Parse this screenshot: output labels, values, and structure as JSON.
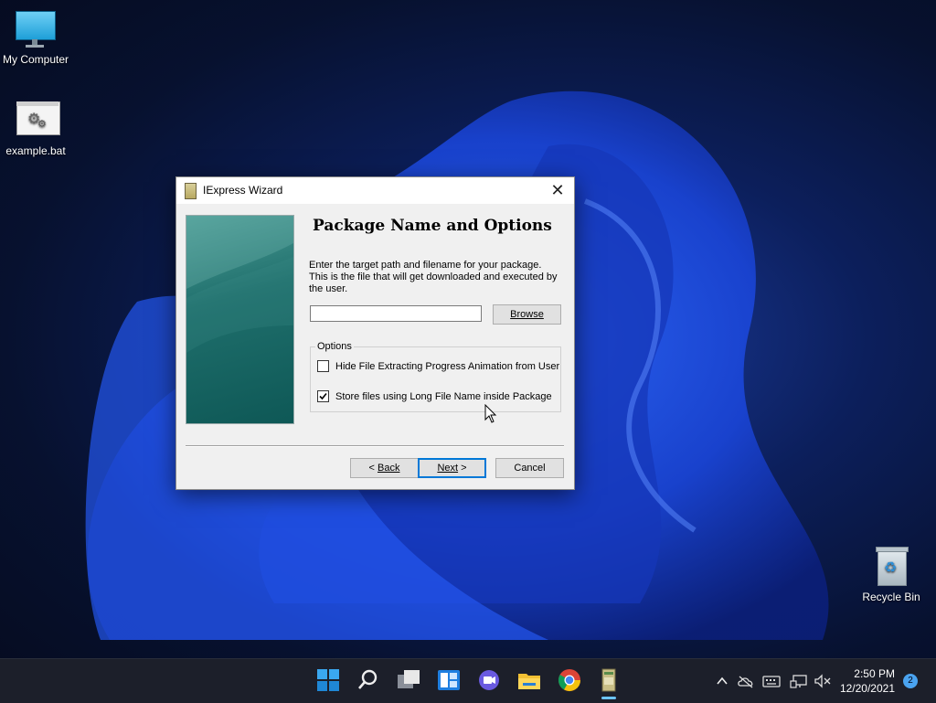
{
  "desktop": {
    "icons": [
      {
        "label": "My Computer"
      },
      {
        "label": "example.bat"
      },
      {
        "label": "Recycle Bin"
      }
    ]
  },
  "dialog": {
    "title": "IExpress Wizard",
    "close_glyph": "✕",
    "heading": "Package Name and Options",
    "description": "Enter the target path and filename for your package. This is the file that will get downloaded and executed by the user.",
    "path_value": "",
    "browse_label": "Browse",
    "options_legend": "Options",
    "options": [
      {
        "label": "Hide File Extracting Progress Animation from User",
        "checked": false
      },
      {
        "label": "Store files using Long File Name inside Package",
        "checked": true
      }
    ],
    "back_prefix": "< ",
    "back_label": "Back",
    "next_label": "Next",
    "next_suffix": " >",
    "cancel_label": "Cancel"
  },
  "taskbar": {
    "apps": [
      "start-icon",
      "search-icon",
      "task-view-icon",
      "widgets-icon",
      "chat-icon",
      "file-explorer-icon",
      "chrome-icon",
      "iexpress-icon"
    ],
    "tray": [
      "chevron-up-icon",
      "onedrive-icon",
      "keyboard-icon",
      "network-icon",
      "volume-muted-icon"
    ],
    "time": "2:50 PM",
    "date": "12/20/2021",
    "notification_count": "2"
  },
  "colors": {
    "accent": "#0078d7",
    "taskbar": "#1c1f2a",
    "wizard_panel": "#1f6f6c"
  }
}
